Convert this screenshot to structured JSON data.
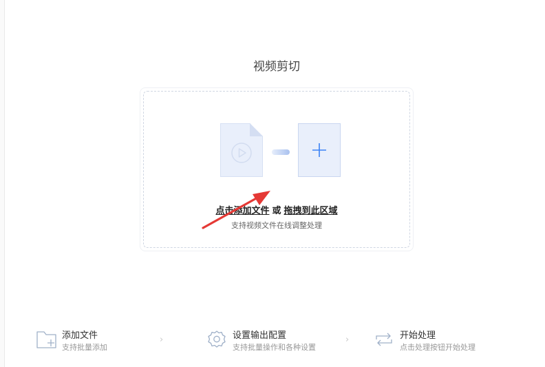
{
  "page": {
    "title": "视频剪切"
  },
  "dropzone": {
    "click_add_label": "点击添加文件",
    "or_label": "或",
    "drag_label": "拖拽到此区域",
    "subtitle": "支持视频文件在线调整处理"
  },
  "steps": [
    {
      "title": "添加文件",
      "desc": "支持批量添加",
      "icon": "folder-add-icon"
    },
    {
      "title": "设置输出配置",
      "desc": "支持批量操作和各种设置",
      "icon": "gear-icon"
    },
    {
      "title": "开始处理",
      "desc": "点击处理按钮开始处理",
      "icon": "repeat-icon"
    }
  ],
  "separator_glyph": "›",
  "colors": {
    "accent": "#3b82f6",
    "card_bg": "#e9effb",
    "arrow": "#e53935"
  }
}
